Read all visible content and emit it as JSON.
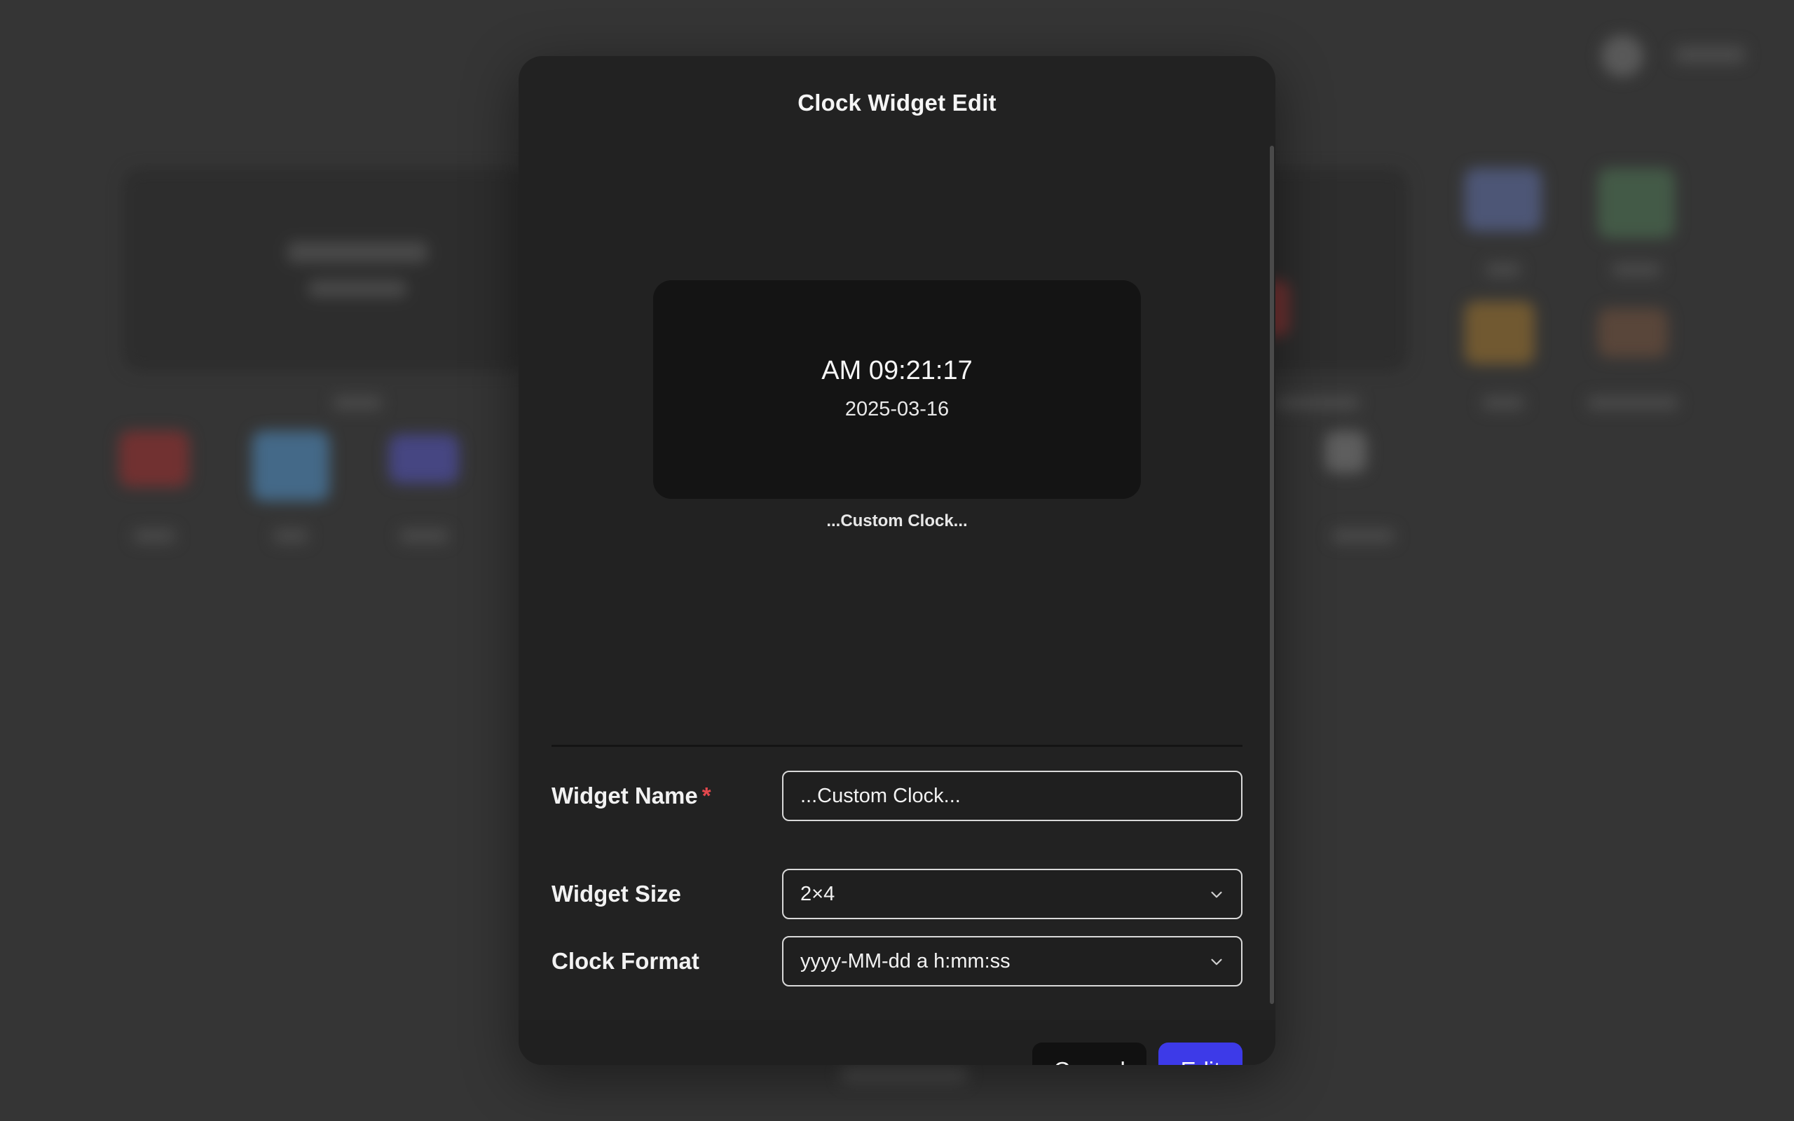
{
  "modal": {
    "title": "Clock Widget Edit"
  },
  "preview": {
    "time": "AM 09:21:17",
    "date": "2025-03-16",
    "caption": "...Custom Clock..."
  },
  "form": {
    "widget_name": {
      "label": "Widget Name",
      "required_mark": "*",
      "value": "...Custom Clock..."
    },
    "widget_size": {
      "label": "Widget Size",
      "value": "2×4"
    },
    "clock_format": {
      "label": "Clock Format",
      "value": "yyyy-MM-dd a h:mm:ss"
    }
  },
  "actions": {
    "cancel_label": "Cancel",
    "edit_label": "Edit"
  },
  "colors": {
    "primary": "#3d3ae8",
    "required": "#e5484d",
    "modal_bg": "#222222",
    "preview_bg": "#141414"
  }
}
